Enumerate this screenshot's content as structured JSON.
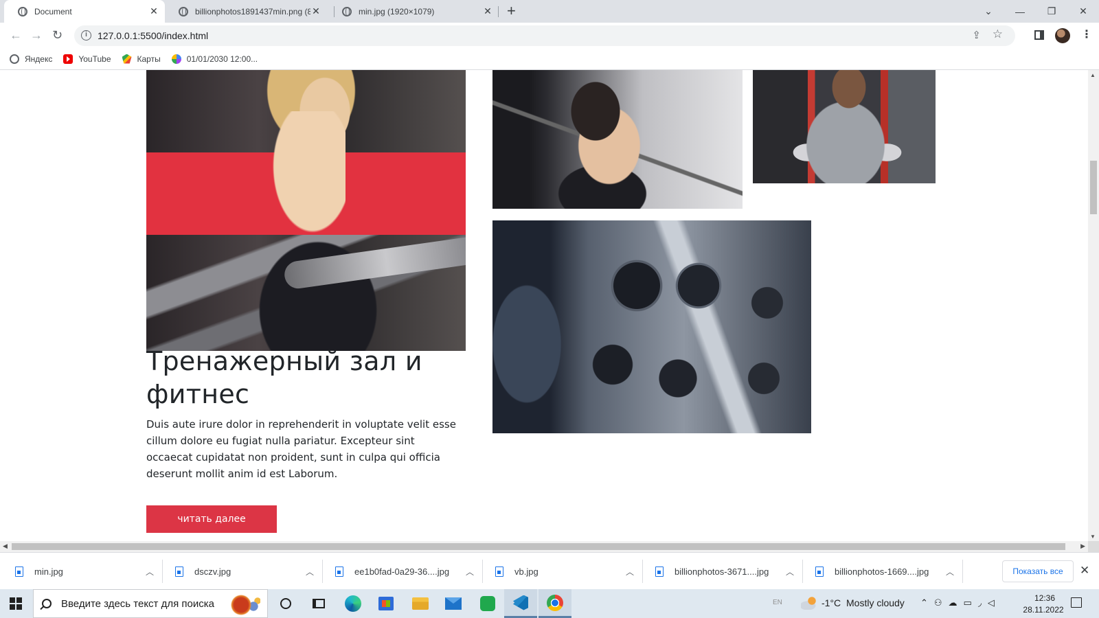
{
  "browser": {
    "tabs": [
      {
        "title": "Document",
        "active": true
      },
      {
        "title": "billionphotos1891437min.png (8",
        "active": false
      },
      {
        "title": "min.jpg (1920×1079)",
        "active": false
      }
    ],
    "address": "127.0.0.1:5500/index.html",
    "bookmarks": [
      "Яндекс",
      "YouTube",
      "Карты",
      "01/01/2030 12:00..."
    ]
  },
  "page": {
    "heading": "Тренажерный зал и фитнес",
    "body": "Duis aute irure dolor in reprehenderit in voluptate velit esse cillum dolore eu fugiat nulla pariatur. Excepteur sint occaecat cupidatat non proident, sunt in culpa qui officia deserunt mollit anim id est Laborum.",
    "read_more": "читать далее",
    "accent_color": "#dc3545"
  },
  "downloads": {
    "items": [
      "min.jpg",
      "dsczv.jpg",
      "ee1b0fad-0a29-36....jpg",
      "vb.jpg",
      "billionphotos-3671....jpg",
      "billionphotos-1669....jpg"
    ],
    "show_all": "Показать все"
  },
  "taskbar": {
    "search_placeholder": "Введите здесь текст для поиска",
    "lang": "EN",
    "temperature": "-1°C",
    "weather": "Mostly cloudy",
    "time": "12:36",
    "date": "28.11.2022"
  }
}
